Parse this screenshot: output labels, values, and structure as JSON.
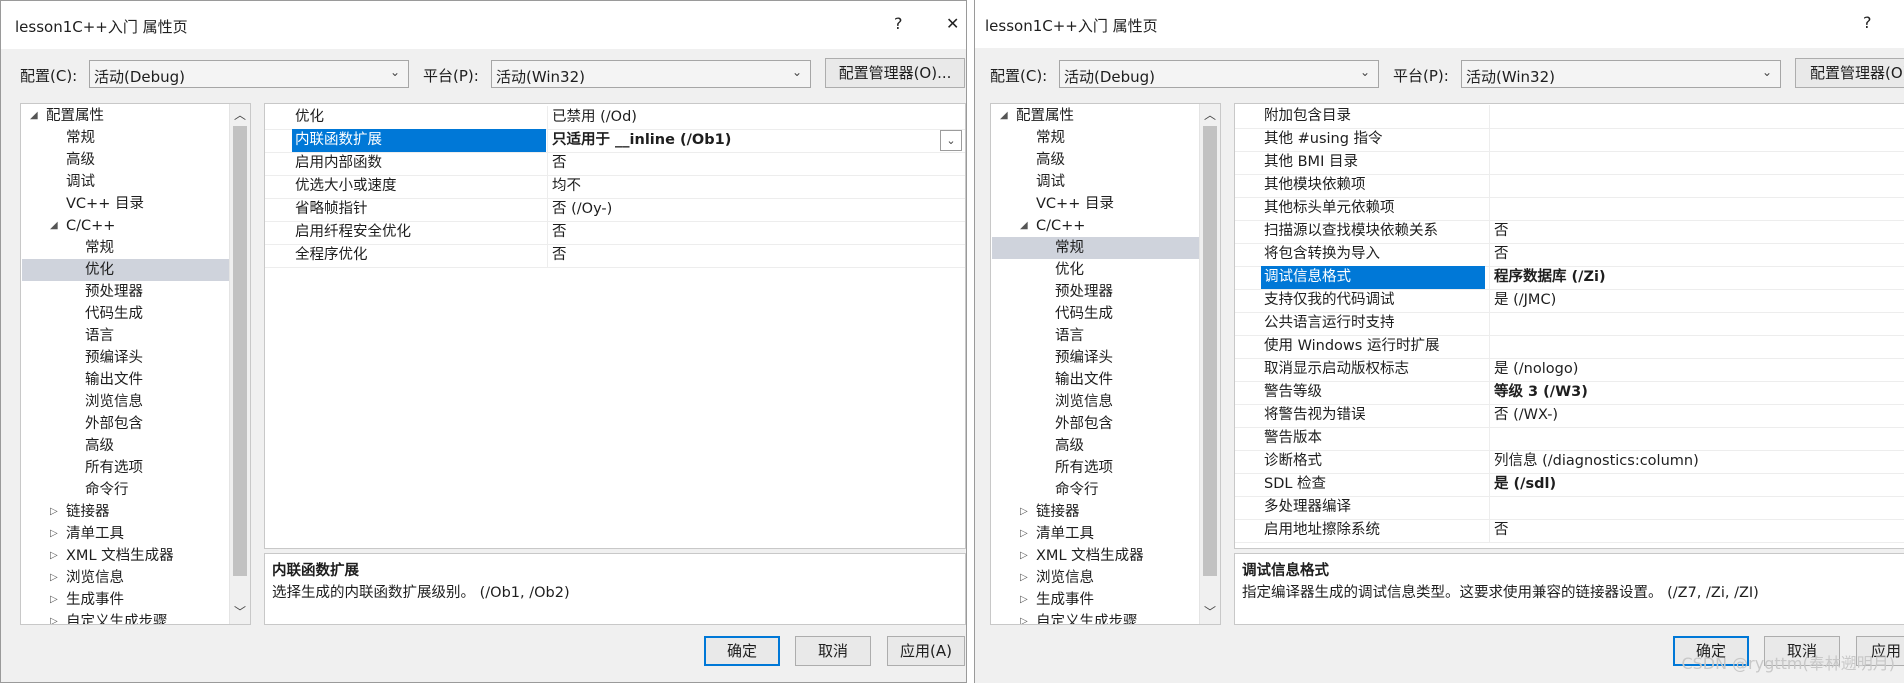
{
  "left": {
    "window_title": "lesson1C++入门 属性页",
    "help_glyph": "?",
    "close_glyph": "✕",
    "config_label": "配置(C):",
    "config_value": "活动(Debug)",
    "platform_label": "平台(P):",
    "platform_value": "活动(Win32)",
    "config_manager_label": "配置管理器(O)...",
    "tree": [
      "配置属性",
      "常规",
      "高级",
      "调试",
      "VC++ 目录",
      "C/C++",
      "常规",
      "优化",
      "预处理器",
      "代码生成",
      "语言",
      "预编译头",
      "输出文件",
      "浏览信息",
      "外部包含",
      "高级",
      "所有选项",
      "命令行",
      "链接器",
      "清单工具",
      "XML 文档生成器",
      "浏览信息",
      "生成事件",
      "自定义生成步骤"
    ],
    "props": [
      {
        "name": "优化",
        "value": "已禁用 (/Od)"
      },
      {
        "name": "内联函数扩展",
        "value": "只适用于 __inline (/Ob1)"
      },
      {
        "name": "启用内部函数",
        "value": "否"
      },
      {
        "name": "优选大小或速度",
        "value": "均不"
      },
      {
        "name": "省略帧指针",
        "value": "否 (/Oy-)"
      },
      {
        "name": "启用纤程安全优化",
        "value": "否"
      },
      {
        "name": "全程序优化",
        "value": "否"
      }
    ],
    "desc_title": "内联函数扩展",
    "desc_text": "选择生成的内联函数扩展级别。     (/Ob1, /Ob2)",
    "ok_label": "确定",
    "cancel_label": "取消",
    "apply_label": "应用(A)"
  },
  "right": {
    "window_title": "lesson1C++入门 属性页",
    "help_glyph": "?",
    "config_label": "配置(C):",
    "config_value": "活动(Debug)",
    "platform_label": "平台(P):",
    "platform_value": "活动(Win32)",
    "config_manager_label": "配置管理器(O)...",
    "tree": [
      "配置属性",
      "常规",
      "高级",
      "调试",
      "VC++ 目录",
      "C/C++",
      "常规",
      "优化",
      "预处理器",
      "代码生成",
      "语言",
      "预编译头",
      "输出文件",
      "浏览信息",
      "外部包含",
      "高级",
      "所有选项",
      "命令行",
      "链接器",
      "清单工具",
      "XML 文档生成器",
      "浏览信息",
      "生成事件",
      "自定义生成步骤"
    ],
    "props": [
      {
        "name": "附加包含目录",
        "value": ""
      },
      {
        "name": "其他 #using 指令",
        "value": ""
      },
      {
        "name": "其他 BMI 目录",
        "value": ""
      },
      {
        "name": "其他模块依赖项",
        "value": ""
      },
      {
        "name": "其他标头单元依赖项",
        "value": ""
      },
      {
        "name": "扫描源以查找模块依赖关系",
        "value": "否"
      },
      {
        "name": "将包含转换为导入",
        "value": "否"
      },
      {
        "name": "调试信息格式",
        "value": "程序数据库 (/Zi)"
      },
      {
        "name": "支持仅我的代码调试",
        "value": "是 (/JMC)"
      },
      {
        "name": "公共语言运行时支持",
        "value": ""
      },
      {
        "name": "使用 Windows 运行时扩展",
        "value": ""
      },
      {
        "name": "取消显示启动版权标志",
        "value": "是 (/nologo)"
      },
      {
        "name": "警告等级",
        "value": "等级 3 (/W3)"
      },
      {
        "name": "将警告视为错误",
        "value": "否 (/WX-)"
      },
      {
        "name": "警告版本",
        "value": ""
      },
      {
        "name": "诊断格式",
        "value": "列信息 (/diagnostics:column)"
      },
      {
        "name": "SDL 检查",
        "value": "是 (/sdl)"
      },
      {
        "name": "多处理器编译",
        "value": ""
      },
      {
        "name": "启用地址擦除系统",
        "value": "否"
      }
    ],
    "desc_title": "调试信息格式",
    "desc_text": "指定编译器生成的调试信息类型。这要求使用兼容的链接器设置。   (/Z7, /Zi, /ZI)",
    "ok_label": "确定",
    "cancel_label": "取消",
    "apply_label": "应用"
  },
  "watermark": "CSDN @rygttm(奉林遡明月)"
}
